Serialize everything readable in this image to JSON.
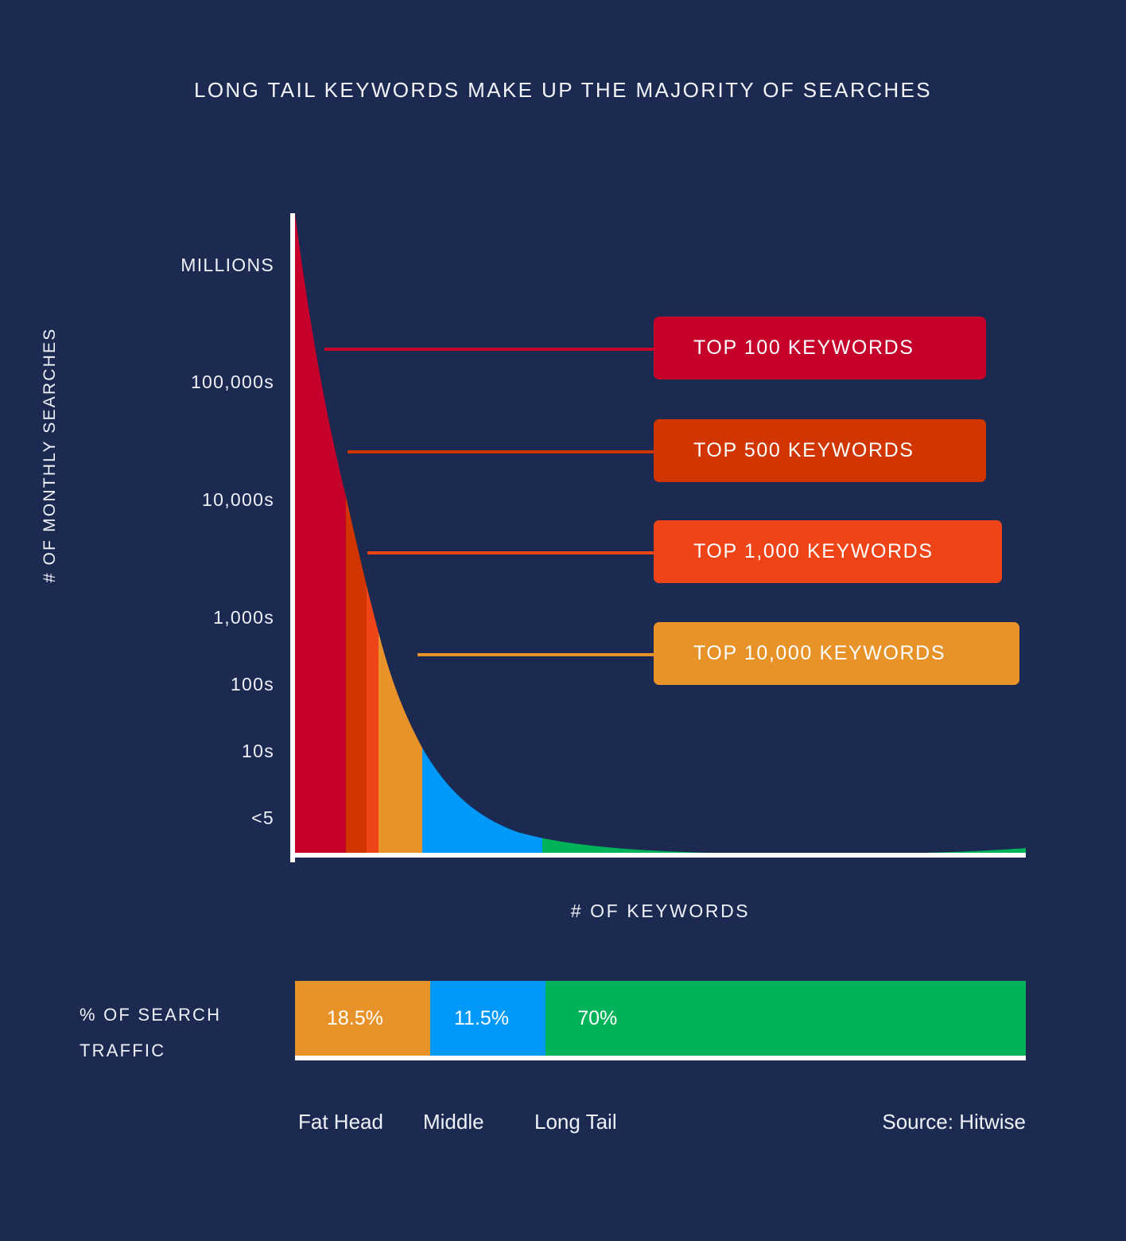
{
  "title": "LONG TAIL KEYWORDS MAKE UP THE MAJORITY OF SEARCHES",
  "colors": {
    "background": "#1c2a52",
    "axis": "#ffffff",
    "text": "#eef1f6",
    "band_top100": "#c4002b",
    "band_top500": "#d13600",
    "band_top1000": "#ef4417",
    "band_top10000": "#e8922a",
    "band_middle": "#0099fa",
    "band_longtail": "#00b259"
  },
  "axes": {
    "ylabel": "# OF MONTHLY SEARCHES",
    "xlabel": "# OF KEYWORDS",
    "yticks": [
      "MILLIONS",
      "100,000s",
      "10,000s",
      "1,000s",
      "100s",
      "10s",
      "<5"
    ]
  },
  "callouts": [
    {
      "label": "TOP 100 KEYWORDS",
      "color": "#c4002b"
    },
    {
      "label": "TOP 500 KEYWORDS",
      "color": "#d13600"
    },
    {
      "label": "TOP 1,000 KEYWORDS",
      "color": "#ef4417"
    },
    {
      "label": "TOP 10,000 KEYWORDS",
      "color": "#e8922a"
    }
  ],
  "traffic": {
    "label_line1": "% OF SEARCH",
    "label_line2": "TRAFFIC",
    "segments": [
      {
        "name": "Fat Head",
        "value": "18.5%",
        "color": "#e8922a"
      },
      {
        "name": "Middle",
        "value": "11.5%",
        "color": "#0099fa"
      },
      {
        "name": "Long Tail",
        "value": "70%",
        "color": "#00b259"
      }
    ]
  },
  "categories": [
    "Fat Head",
    "Middle",
    "Long Tail"
  ],
  "source": "Source: Hitwise",
  "chart_data": {
    "type": "area",
    "title": "LONG TAIL KEYWORDS MAKE UP THE MAJORITY OF SEARCHES",
    "xlabel": "# OF KEYWORDS",
    "ylabel": "# OF MONTHLY SEARCHES",
    "grid": false,
    "legend_position": "right-callouts",
    "ytick_labels": [
      "MILLIONS",
      "100,000s",
      "10,000s",
      "1,000s",
      "100s",
      "10s",
      "<5"
    ],
    "note": "Log-scale long-tail search demand curve: monthly search volume falls steeply as keyword rank increases.",
    "bands": [
      {
        "name": "TOP 100 KEYWORDS",
        "color": "#c4002b",
        "x_start_pct": 0,
        "x_end_pct": 7.0,
        "callout_y_value": "between MILLIONS and 100,000s"
      },
      {
        "name": "TOP 500 KEYWORDS",
        "color": "#d13600",
        "x_start_pct": 7.0,
        "x_end_pct": 9.8,
        "callout_y_value": "between 100,000s and 10,000s"
      },
      {
        "name": "TOP 1,000 KEYWORDS",
        "color": "#ef4417",
        "x_start_pct": 9.8,
        "x_end_pct": 11.4,
        "callout_y_value": "between 10,000s and 1,000s"
      },
      {
        "name": "TOP 10,000 KEYWORDS",
        "color": "#e8922a",
        "x_start_pct": 11.4,
        "x_end_pct": 17.4,
        "callout_y_value": "between 1,000s and 100s"
      },
      {
        "name": "Middle",
        "color": "#0099fa",
        "x_start_pct": 17.4,
        "x_end_pct": 33.8
      },
      {
        "name": "Long Tail",
        "color": "#00b259",
        "x_start_pct": 33.8,
        "x_end_pct": 100
      }
    ],
    "curve_points": [
      {
        "x_pct": 0,
        "y_pct": 100
      },
      {
        "x_pct": 2,
        "y_pct": 79
      },
      {
        "x_pct": 4,
        "y_pct": 62
      },
      {
        "x_pct": 7,
        "y_pct": 44
      },
      {
        "x_pct": 9.8,
        "y_pct": 32
      },
      {
        "x_pct": 11.4,
        "y_pct": 26
      },
      {
        "x_pct": 14,
        "y_pct": 18
      },
      {
        "x_pct": 17.4,
        "y_pct": 11.5
      },
      {
        "x_pct": 22,
        "y_pct": 7
      },
      {
        "x_pct": 28,
        "y_pct": 4
      },
      {
        "x_pct": 33.8,
        "y_pct": 2.6
      },
      {
        "x_pct": 50,
        "y_pct": 1.7
      },
      {
        "x_pct": 75,
        "y_pct": 1.3
      },
      {
        "x_pct": 100,
        "y_pct": 1.2
      }
    ],
    "traffic_share": {
      "type": "bar",
      "orientation": "stacked-horizontal",
      "categories": [
        "Fat Head",
        "Middle",
        "Long Tail"
      ],
      "values": [
        18.5,
        11.5,
        70
      ],
      "labels": [
        "18.5%",
        "11.5%",
        "70%"
      ],
      "ylabel": "% OF SEARCH TRAFFIC",
      "colors": [
        "#e8922a",
        "#0099fa",
        "#00b259"
      ]
    },
    "source": "Source: Hitwise"
  }
}
